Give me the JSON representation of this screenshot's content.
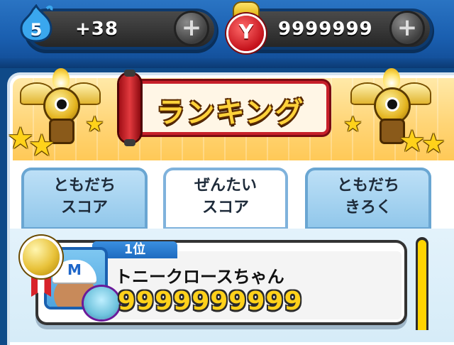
{
  "header": {
    "stamina_count": "5",
    "stamina_bonus": "+38",
    "money": "9999999",
    "money_icon_letter": "Y",
    "plus_glyph": "+"
  },
  "banner": {
    "title": "ランキング"
  },
  "tabs": [
    {
      "label": "ともだち\nスコア",
      "active": false
    },
    {
      "label": "ぜんたい\nスコア",
      "active": true
    },
    {
      "label": "ともだち\nきろく",
      "active": false
    }
  ],
  "ranking": {
    "entries": [
      {
        "rank_label": "1位",
        "avatar_letter": "M",
        "player_name": "トニークロースちゃん",
        "score": "9999999999"
      }
    ]
  },
  "colors": {
    "top_bar": "#1a5fb0",
    "banner": "#ffd577",
    "tab_inactive": "#8fc6ea",
    "score_gold": "#ffd11a",
    "rank_blue": "#1e6bc0"
  },
  "icons": {
    "stamina": "blue-flame-icon",
    "money": "coin-purse-icon",
    "add": "plus-icon",
    "medal": "gold-medal-icon",
    "trophy": "winged-trophy-icon",
    "star": "star-icon"
  }
}
